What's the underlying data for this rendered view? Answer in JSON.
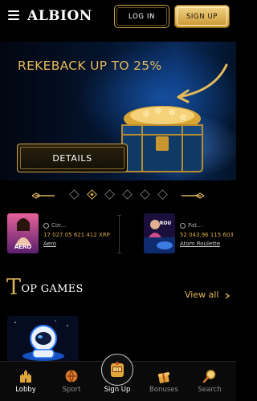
{
  "header": {
    "logo": "ALBION",
    "login_label": "LOG IN",
    "signup_label": "SIGN UP"
  },
  "banner": {
    "title": "REKEBACK UP TO 25%",
    "button_label": "DETAILS"
  },
  "carousel": {
    "dot_count": 6,
    "active_index": 1
  },
  "winners": [
    {
      "user": "Cor...",
      "amount": "17 027.05 621 412 XRP",
      "game": "Aero",
      "thumb_label": "AERO"
    },
    {
      "user": "Pat...",
      "amount": "52 043.96 115 603",
      "game": "Atom Roulette",
      "thumb_label": "ROU"
    }
  ],
  "top_games": {
    "title_initial": "T",
    "title_rest": "OP GAMES",
    "view_all": "View all"
  },
  "bottom_nav": {
    "lobby": "Lobby",
    "sport": "Sport",
    "signup": "Sign Up",
    "bonuses": "Bonuses",
    "search": "Search"
  },
  "colors": {
    "gold": "#d9b15a",
    "background": "#000000",
    "muted": "#8f8f8f"
  }
}
